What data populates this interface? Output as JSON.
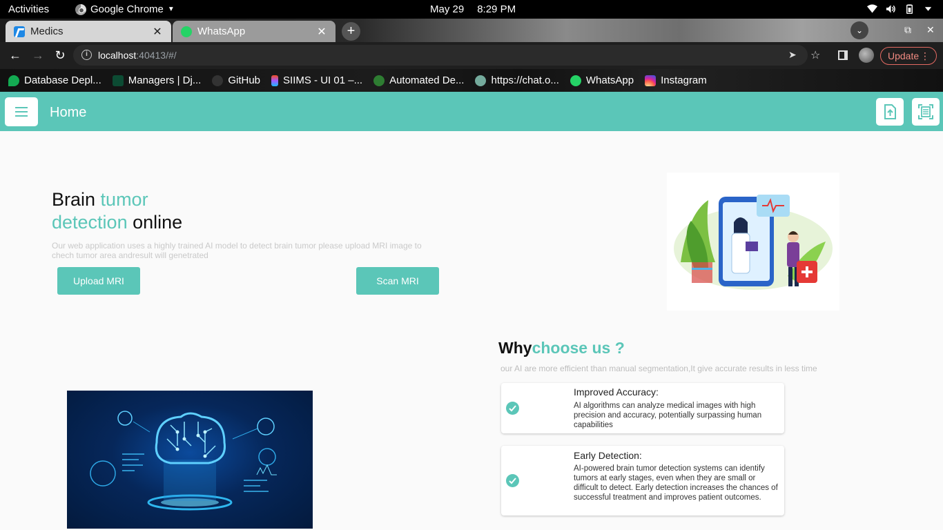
{
  "gnome": {
    "activities": "Activities",
    "app_name": "Google Chrome",
    "date": "May 29",
    "time": "8:29 PM"
  },
  "tabs": [
    {
      "label": "Medics",
      "active": true,
      "icon": "flutter-icon"
    },
    {
      "label": "WhatsApp",
      "active": false,
      "icon": "whatsapp-icon"
    }
  ],
  "omnibox": {
    "host": "localhost",
    "rest": ":40413/#/"
  },
  "toolbar": {
    "update_label": "Update"
  },
  "bookmarks": [
    {
      "label": "Database Depl...",
      "color": "#13aa52"
    },
    {
      "label": "Managers | Dj...",
      "color": "#0c4b33"
    },
    {
      "label": "GitHub",
      "color": "#333333"
    },
    {
      "label": "SIIMS - UI 01 –...",
      "color": "#a259ff"
    },
    {
      "label": "Automated De...",
      "color": "#2e7d32"
    },
    {
      "label": "https://chat.o...",
      "color": "#74aa9c"
    },
    {
      "label": "WhatsApp",
      "color": "#25d366"
    },
    {
      "label": "Instagram",
      "color": "#e1306c"
    }
  ],
  "appbar": {
    "title": "Home",
    "color": "#5bc6b8"
  },
  "hero": {
    "title_1": "Brain ",
    "title_accent_1": "tumor",
    "title_accent_2": "detection",
    "title_2": " online",
    "description": "Our web application uses a highly trained AI model to detect brain tumor please upload MRI image to chech tumor area andresult will genetrated",
    "upload_label": "Upload MRI",
    "scan_label": "Scan MRI"
  },
  "why": {
    "title_plain": "Why",
    "title_accent": "choose us ?",
    "subtitle": "our AI are more efficient than manual segmentation,It give accurate results in less time",
    "cards": [
      {
        "title": "Improved Accuracy:",
        "body": "AI algorithms can analyze medical images with high precision and accuracy, potentially surpassing human capabilities"
      },
      {
        "title": "Early Detection:",
        "body": "AI-powered brain tumor detection systems can identify tumors at early stages, even when they are small or difficult to detect. Early detection increases the chances of successful treatment and improves patient outcomes."
      }
    ]
  }
}
